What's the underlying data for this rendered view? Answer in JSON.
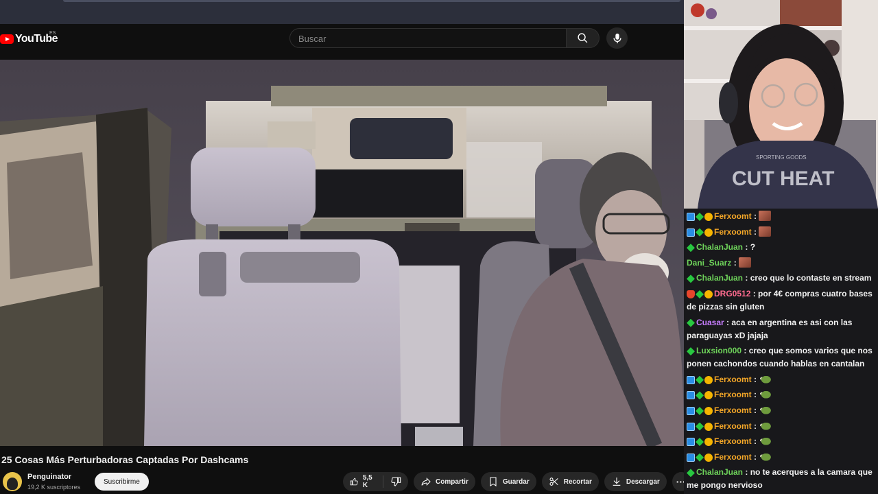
{
  "youtube": {
    "logo_text": "YouTube",
    "region": "ES",
    "search_placeholder": "Buscar",
    "video_title": "25 Cosas Más Perturbadoras Captadas Por Dashcams",
    "channel_name": "Penguinator",
    "subscribers": "19,2 K suscriptores",
    "subscribe_label": "Suscribirme",
    "like_count": "5,5 K",
    "share_label": "Compartir",
    "save_label": "Guardar",
    "clip_label": "Recortar",
    "download_label": "Descargar",
    "more_label": "···"
  },
  "chat": {
    "messages": [
      {
        "badges": [
          "prime",
          "gem",
          "coin"
        ],
        "user": "Ferxoomt",
        "color": "#f4a728",
        "text": "",
        "emote": "kiss"
      },
      {
        "badges": [
          "prime",
          "gem",
          "coin"
        ],
        "user": "Ferxoomt",
        "color": "#f4a728",
        "text": "",
        "emote": "kiss"
      },
      {
        "badges": [
          "gem"
        ],
        "user": "ChalanJuan",
        "color": "#6ed35a",
        "text": "?",
        "emote": ""
      },
      {
        "badges": [],
        "user": "Dani_Suarz",
        "color": "#6ed35a",
        "text": "",
        "emote": "kiss"
      },
      {
        "badges": [
          "gem"
        ],
        "user": "ChalanJuan",
        "color": "#6ed35a",
        "text": "creo que lo contaste en stream",
        "emote": ""
      },
      {
        "badges": [
          "shield",
          "gem",
          "coin"
        ],
        "user": "DRG0512",
        "color": "#ff6b8f",
        "text": "por 4€ compras cuatro bases de pizzas sin gluten",
        "emote": ""
      },
      {
        "badges": [
          "gem"
        ],
        "user": "Cuasar",
        "color": "#c77dff",
        "text": "aca en argentina es asi con las paraguayas xD jajaja",
        "emote": ""
      },
      {
        "badges": [
          "gem"
        ],
        "user": "Luxsion000",
        "color": "#6ed35a",
        "text": "creo que somos varios que nos ponen cachondos cuando hablas en cantalan",
        "emote": ""
      },
      {
        "badges": [
          "prime",
          "gem",
          "coin"
        ],
        "user": "Ferxoomt",
        "color": "#f4a728",
        "text": "",
        "emote": "frog"
      },
      {
        "badges": [
          "prime",
          "gem",
          "coin"
        ],
        "user": "Ferxoomt",
        "color": "#f4a728",
        "text": "",
        "emote": "frog"
      },
      {
        "badges": [
          "prime",
          "gem",
          "coin"
        ],
        "user": "Ferxoomt",
        "color": "#f4a728",
        "text": "",
        "emote": "frog"
      },
      {
        "badges": [
          "prime",
          "gem",
          "coin"
        ],
        "user": "Ferxoomt",
        "color": "#f4a728",
        "text": "",
        "emote": "frog"
      },
      {
        "badges": [
          "prime",
          "gem",
          "coin"
        ],
        "user": "Ferxoomt",
        "color": "#f4a728",
        "text": "",
        "emote": "frog"
      },
      {
        "badges": [
          "prime",
          "gem",
          "coin"
        ],
        "user": "Ferxoomt",
        "color": "#f4a728",
        "text": "",
        "emote": "frog"
      },
      {
        "badges": [
          "gem"
        ],
        "user": "ChalanJuan",
        "color": "#6ed35a",
        "text": "no te acerques a la camara que me pongo nervioso",
        "emote": ""
      }
    ]
  },
  "colors": {
    "youtube_red": "#ff0000",
    "chat_bg": "#18181b"
  },
  "icons": [
    "search-icon",
    "mic-icon",
    "thumbs-up-icon",
    "thumbs-down-icon",
    "share-icon",
    "bookmark-icon",
    "scissors-icon",
    "download-icon"
  ]
}
